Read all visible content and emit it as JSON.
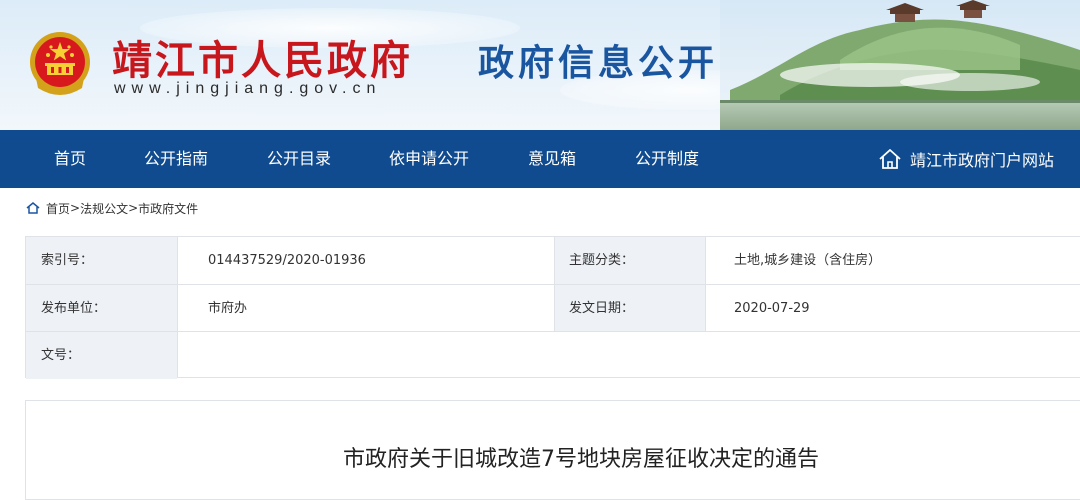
{
  "header": {
    "site_title": "靖江市人民政府",
    "site_url": "www.jingjiang.gov.cn",
    "subtitle": "政府信息公开"
  },
  "nav": {
    "items": [
      {
        "label": "首页"
      },
      {
        "label": "公开指南"
      },
      {
        "label": "公开目录"
      },
      {
        "label": "依申请公开"
      },
      {
        "label": "意见箱"
      },
      {
        "label": "公开制度"
      }
    ],
    "portal_link": "靖江市政府门户网站"
  },
  "breadcrumb": {
    "items": [
      "首页",
      "法规公文",
      "市政府文件"
    ],
    "separator": ">"
  },
  "info": {
    "index_label": "索引号：",
    "index_value": "014437529/2020-01936",
    "topic_label": "主题分类：",
    "topic_value": "土地,城乡建设（含住房）",
    "publisher_label": "发布单位：",
    "publisher_value": "市府办",
    "date_label": "发文日期：",
    "date_value": "2020-07-29",
    "doc_no_label": "文号：",
    "doc_no_value": ""
  },
  "article": {
    "title": "市政府关于旧城改造7号地块房屋征收决定的通告"
  },
  "colors": {
    "nav_bg": "#0f4b8e",
    "title_red": "#c8161d",
    "subtitle_blue": "#1a56a0",
    "label_bg": "#eef2f7"
  }
}
